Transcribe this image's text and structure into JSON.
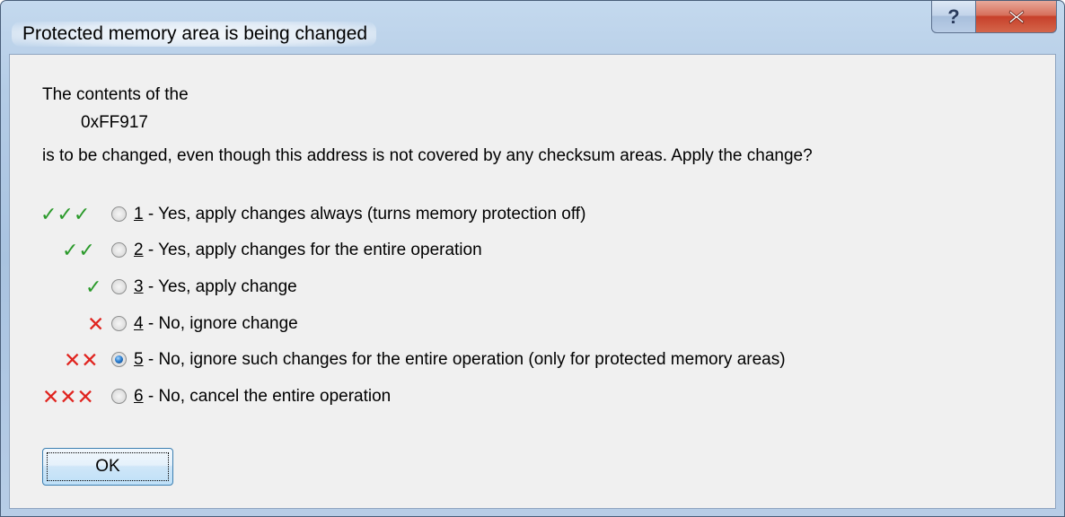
{
  "window": {
    "title": "Protected memory area is being changed",
    "help_label": "?",
    "help_icon": "help-question-icon",
    "close_icon": "close-x-icon"
  },
  "message": {
    "line1": "The contents of the",
    "address": "0xFF917",
    "line3": "is to be changed, even though this address is not covered by any checksum areas. Apply the change?"
  },
  "options": [
    {
      "marks": "✓✓✓",
      "mark_type": "check",
      "mark_count": 3,
      "number": "1",
      "text": " - Yes, apply changes always (turns memory protection off)",
      "selected": false
    },
    {
      "marks": "✓✓",
      "mark_type": "check",
      "mark_count": 2,
      "number": "2",
      "text": " - Yes, apply changes for the entire operation",
      "selected": false
    },
    {
      "marks": "✓",
      "mark_type": "check",
      "mark_count": 1,
      "number": "3",
      "text": " - Yes, apply change",
      "selected": false
    },
    {
      "marks": "✕",
      "mark_type": "cross",
      "mark_count": 1,
      "number": "4",
      "text": " - No, ignore change",
      "selected": false
    },
    {
      "marks": "✕✕",
      "mark_type": "cross",
      "mark_count": 2,
      "number": "5",
      "text": " - No, ignore such changes for the entire operation (only for protected memory areas)",
      "selected": true
    },
    {
      "marks": "✕✕✕",
      "mark_type": "cross",
      "mark_count": 3,
      "number": "6",
      "text": " - No, cancel the entire operation",
      "selected": false
    }
  ],
  "buttons": {
    "ok_label": "OK"
  },
  "colors": {
    "check": "#2b9a2b",
    "cross": "#e0241f",
    "title_bar": "#b4cce6",
    "close_button": "#c7402a"
  }
}
